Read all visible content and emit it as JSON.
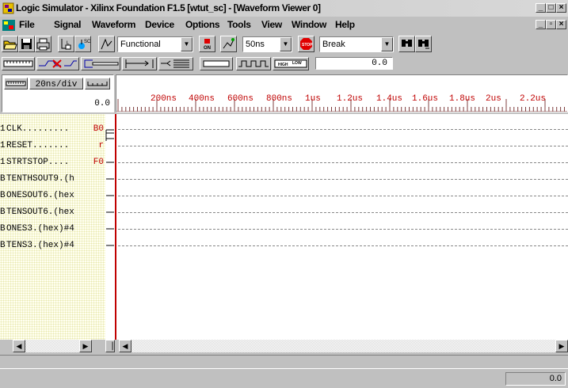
{
  "window": {
    "title": "Logic Simulator - Xilinx Foundation F1.5 [wtut_sc] - [Waveform Viewer 0]",
    "icon": "logic-simulator-app-icon"
  },
  "menu": [
    {
      "label": "File",
      "icon": "mdi-child-icon"
    },
    {
      "label": "Signal"
    },
    {
      "label": "Waveform"
    },
    {
      "label": "Device"
    },
    {
      "label": "Options"
    },
    {
      "label": "Tools"
    },
    {
      "label": "View"
    },
    {
      "label": "Window"
    },
    {
      "label": "Help"
    }
  ],
  "toolbar": {
    "mode": "Functional",
    "step": "50ns",
    "break_mode": "Break",
    "icons": [
      "open-folder-icon",
      "save-disk-icon",
      "print-icon",
      "probe-icon",
      "sc-probe-icon",
      "trace-icon",
      "on-switch-icon",
      "step-waveform-icon",
      "stop-icon",
      "find-icon",
      "find-next-icon"
    ]
  },
  "toolbar2": {
    "zoom_value": "0.0",
    "icons": [
      "ruler-icon",
      "zoom-in-icon",
      "zoom-out-icon",
      "marker-icon",
      "bus-icon",
      "waveform-box-icon",
      "clock-pattern-icon",
      "high-low-icon"
    ]
  },
  "scale": {
    "per_div": "20ns/div",
    "cursor_value": "0.0",
    "ticks": [
      "200ns",
      "400ns",
      "600ns",
      "800ns",
      "1us",
      "1.2us",
      "1.4us",
      "1.6us",
      "1.8us",
      "2us",
      "2.2us"
    ]
  },
  "signals": [
    {
      "type": "1",
      "name": "CLK.........",
      "value": "B0"
    },
    {
      "type": "1",
      "name": "RESET.......",
      "value": "r"
    },
    {
      "type": "1",
      "name": "STRTSTOP....",
      "value": "F0"
    },
    {
      "type": "B",
      "name": "TENTHSOUT9.(h",
      "value": ""
    },
    {
      "type": "B",
      "name": "ONESOUT6.(hex",
      "value": ""
    },
    {
      "type": "B",
      "name": "TENSOUT6.(hex",
      "value": ""
    },
    {
      "type": "B",
      "name": "ONES3.(hex)#4",
      "value": ""
    },
    {
      "type": "B",
      "name": "TENS3.(hex)#4",
      "value": ""
    }
  ],
  "status": {
    "value": "0.0"
  }
}
